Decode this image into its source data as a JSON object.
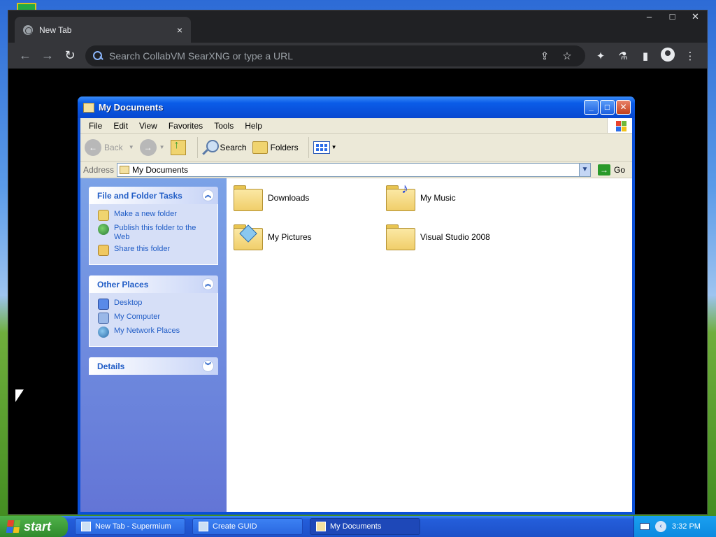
{
  "browser": {
    "tab_title": "New Tab",
    "tab_close": "×",
    "window_controls": [
      "–",
      "□",
      "✕"
    ],
    "omnibox_placeholder": "Search CollabVM SearXNG or type a URL",
    "nav": {
      "back": "←",
      "forward": "→",
      "reload": "↻"
    },
    "omni_icons": {
      "share": "⇪",
      "bookmark": "☆"
    },
    "right_icons": {
      "extensions": "✦",
      "labs": "⚗",
      "sidebar": "▮",
      "menu": "⋮"
    }
  },
  "explorer": {
    "title": "My Documents",
    "menu": [
      "File",
      "Edit",
      "View",
      "Favorites",
      "Tools",
      "Help"
    ],
    "toolbar": {
      "back": "Back",
      "search": "Search",
      "folders": "Folders"
    },
    "address_label": "Address",
    "address_value": "My Documents",
    "go_label": "Go",
    "panels": {
      "file_tasks": {
        "title": "File and Folder Tasks",
        "items": [
          "Make a new folder",
          "Publish this folder to the Web",
          "Share this folder"
        ]
      },
      "other_places": {
        "title": "Other Places",
        "items": [
          "Desktop",
          "My Computer",
          "My Network Places"
        ]
      },
      "details": {
        "title": "Details"
      }
    },
    "items": [
      "Downloads",
      "My Music",
      "My Pictures",
      "Visual Studio 2008"
    ]
  },
  "taskbar": {
    "start_label": "start",
    "buttons": [
      "New Tab - Supermium",
      "Create GUID",
      "My Documents"
    ],
    "clock": "3:32 PM"
  }
}
